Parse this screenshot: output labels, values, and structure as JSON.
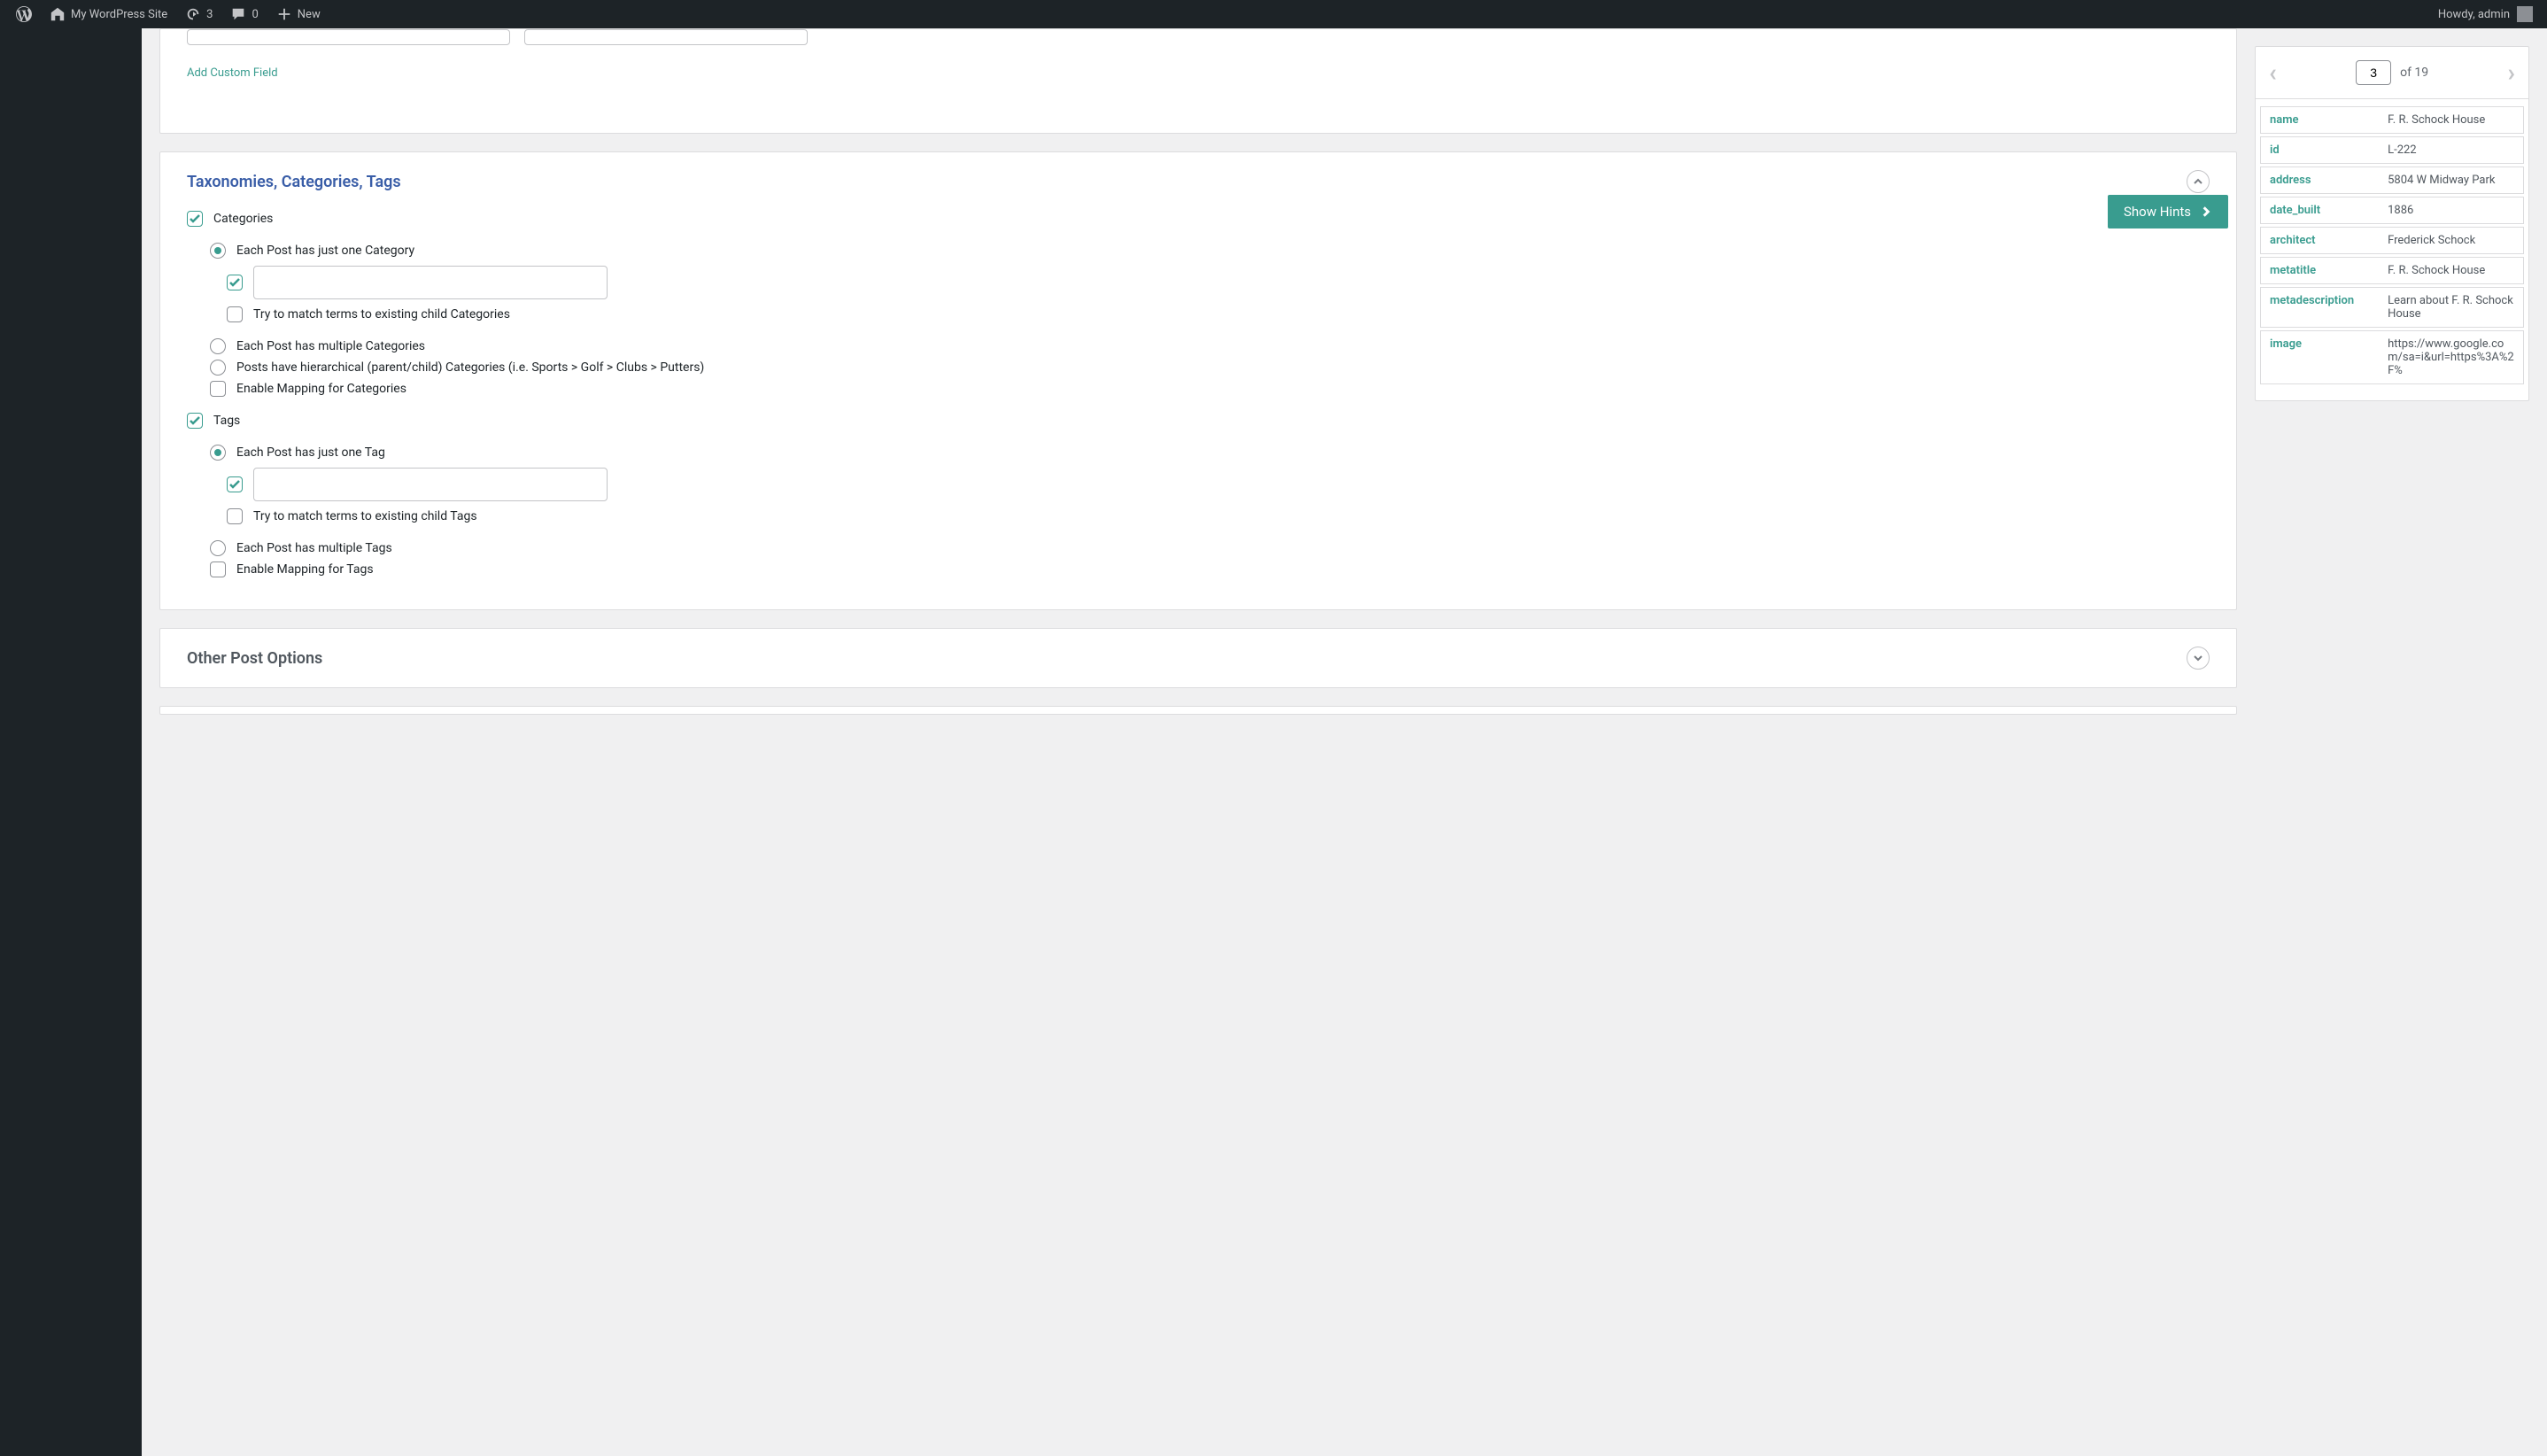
{
  "admin_bar": {
    "site_name": "My WordPress Site",
    "updates": "3",
    "comments": "0",
    "new_label": "New",
    "greeting": "Howdy, admin"
  },
  "top_panel": {
    "add_custom_field": "Add Custom Field"
  },
  "taxonomies": {
    "title": "Taxonomies, Categories, Tags",
    "categories_label": "Categories",
    "cat_one": "Each Post has just one Category",
    "cat_match_child": "Try to match terms to existing child Categories",
    "cat_multiple": "Each Post has multiple Categories",
    "cat_hierarchical": "Posts have hierarchical (parent/child) Categories (i.e. Sports > Golf > Clubs > Putters)",
    "cat_mapping": "Enable Mapping for Categories",
    "tags_label": "Tags",
    "tag_one": "Each Post has just one Tag",
    "tag_match_child": "Try to match terms to existing child Tags",
    "tag_multiple": "Each Post has multiple Tags",
    "tag_mapping": "Enable Mapping for Tags"
  },
  "other_options": {
    "title": "Other Post Options"
  },
  "show_hints": "Show Hints",
  "pager": {
    "current": "3",
    "total_text": "of 19"
  },
  "record": {
    "name_key": "name",
    "name_val": "F. R. Schock House",
    "id_key": "id",
    "id_val": "L-222",
    "address_key": "address",
    "address_val": "5804 W Midway Park",
    "date_built_key": "date_built",
    "date_built_val": "1886",
    "architect_key": "architect",
    "architect_val": "Frederick Schock",
    "metatitle_key": "metatitle",
    "metatitle_val": "F. R. Schock House",
    "metadescription_key": "metadescription",
    "metadescription_val": "Learn about F. R. Schock House",
    "image_key": "image",
    "image_val": "https://www.google.com/sa=i&url=https%3A%2F%"
  }
}
